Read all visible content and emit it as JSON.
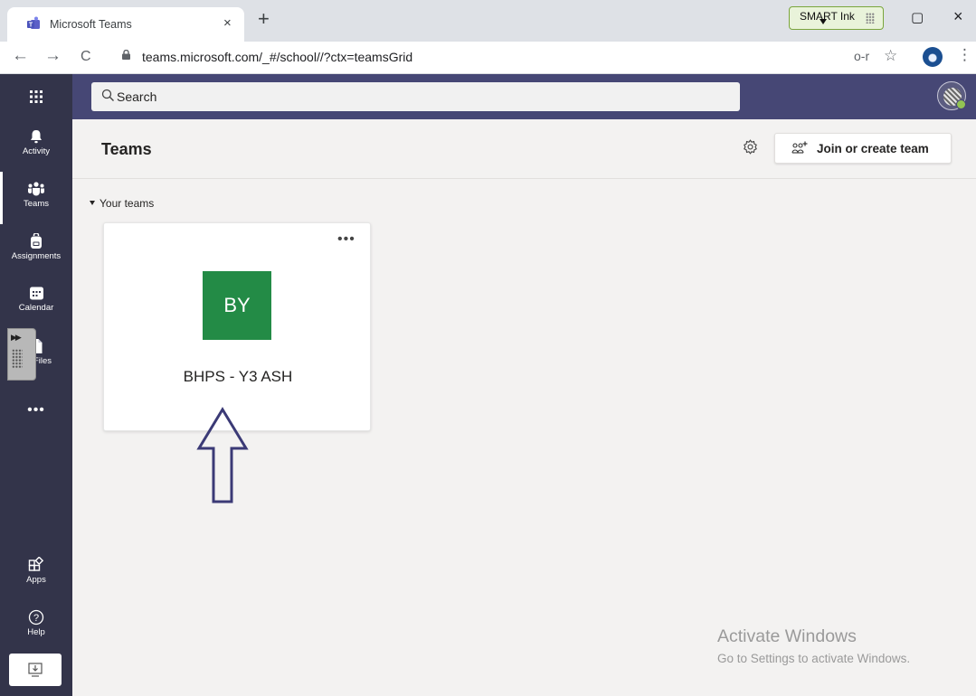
{
  "browser": {
    "tab_title": "Microsoft Teams",
    "tab_close": "×",
    "new_tab": "+",
    "url": "teams.microsoft.com/_#/school//?ctx=teamsGrid",
    "back": "←",
    "forward": "→",
    "reload": "C",
    "smart_ink_label": "SMART Ink",
    "restore_button": "▢",
    "close_button": "×",
    "menu": "⋮",
    "star": "☆",
    "key": "o-r"
  },
  "header": {
    "waffle": "⁝⁝⁝",
    "search_placeholder": "Search"
  },
  "rail": {
    "items": [
      {
        "label": "Activity",
        "icon": "bell-icon"
      },
      {
        "label": "Teams",
        "icon": "teams-icon"
      },
      {
        "label": "Assignments",
        "icon": "backpack-icon"
      },
      {
        "label": "Calendar",
        "icon": "calendar-icon"
      },
      {
        "label": "Files",
        "icon": "file-icon"
      },
      {
        "label": "Apps",
        "icon": "apps-icon"
      },
      {
        "label": "Help",
        "icon": "help-icon"
      }
    ],
    "more": "•••",
    "active_index": 1,
    "side_arrows": "▶▶"
  },
  "main": {
    "title": "Teams",
    "join_label": "Join or create team",
    "section_title": "Your teams",
    "teams": [
      {
        "initials": "BY",
        "name": "BHPS - Y3 ASH",
        "tile_color": "#238b46",
        "more": "•••"
      }
    ]
  },
  "watermark": {
    "title": "Activate Windows",
    "subtitle": "Go to Settings to activate Windows."
  },
  "colors": {
    "app_header": "#464775",
    "rail": "#33344a",
    "canvas": "#f3f2f1",
    "annotation_arrow": "#3b3a76"
  }
}
